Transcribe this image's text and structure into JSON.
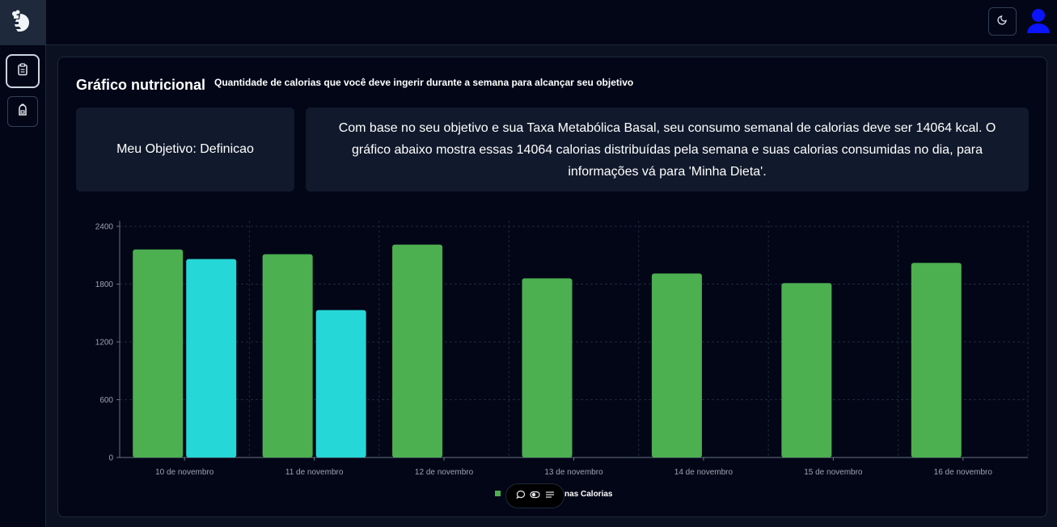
{
  "app": {
    "logo_icon": "chef-logo-icon"
  },
  "sidebar": {
    "items": [
      {
        "name": "clipboard",
        "icon": "clipboard-icon",
        "active": true
      },
      {
        "name": "backpack",
        "icon": "backpack-icon",
        "active": false
      }
    ]
  },
  "header": {
    "theme_icon": "moon-icon",
    "avatar_icon": "user-icon"
  },
  "card": {
    "title": "Gráfico nutricional",
    "subtitle": "Quantidade de calorias que você deve ingerir durante a semana para alcançar seu objetivo",
    "objective": "Meu Objetivo: Definicao",
    "description": "Com base no seu objetivo e sua Taxa Metabólica Basal, seu consumo semanal de calorias deve ser 14064 kcal. O gráfico abaixo mostra essas 14064 calorias distribuídas pela semana e suas calorias consumidas no dia, para informações vá para 'Minha Dieta'."
  },
  "chart_data": {
    "type": "bar",
    "categories": [
      "10 de novembro",
      "11 de novembro",
      "12 de novembro",
      "13 de novembro",
      "14 de novembro",
      "15 de novembro",
      "16 de novembro"
    ],
    "series": [
      {
        "name": "",
        "color": "#4caf50",
        "values": [
          2160,
          2110,
          2210,
          1860,
          1910,
          1810,
          2020
        ]
      },
      {
        "name": "",
        "color": "#26d7d7",
        "values": [
          2060,
          1530,
          null,
          null,
          null,
          null,
          null
        ]
      }
    ],
    "yticks": [
      0,
      600,
      1200,
      1800,
      2400
    ],
    "ylim": [
      0,
      2400
    ],
    "legend_text": "nas Calorias",
    "grid": true,
    "legend_position": "bottom-center"
  },
  "float_toolbar": {
    "icons": [
      "comment-icon",
      "toggle-icon",
      "menu-icon"
    ]
  }
}
